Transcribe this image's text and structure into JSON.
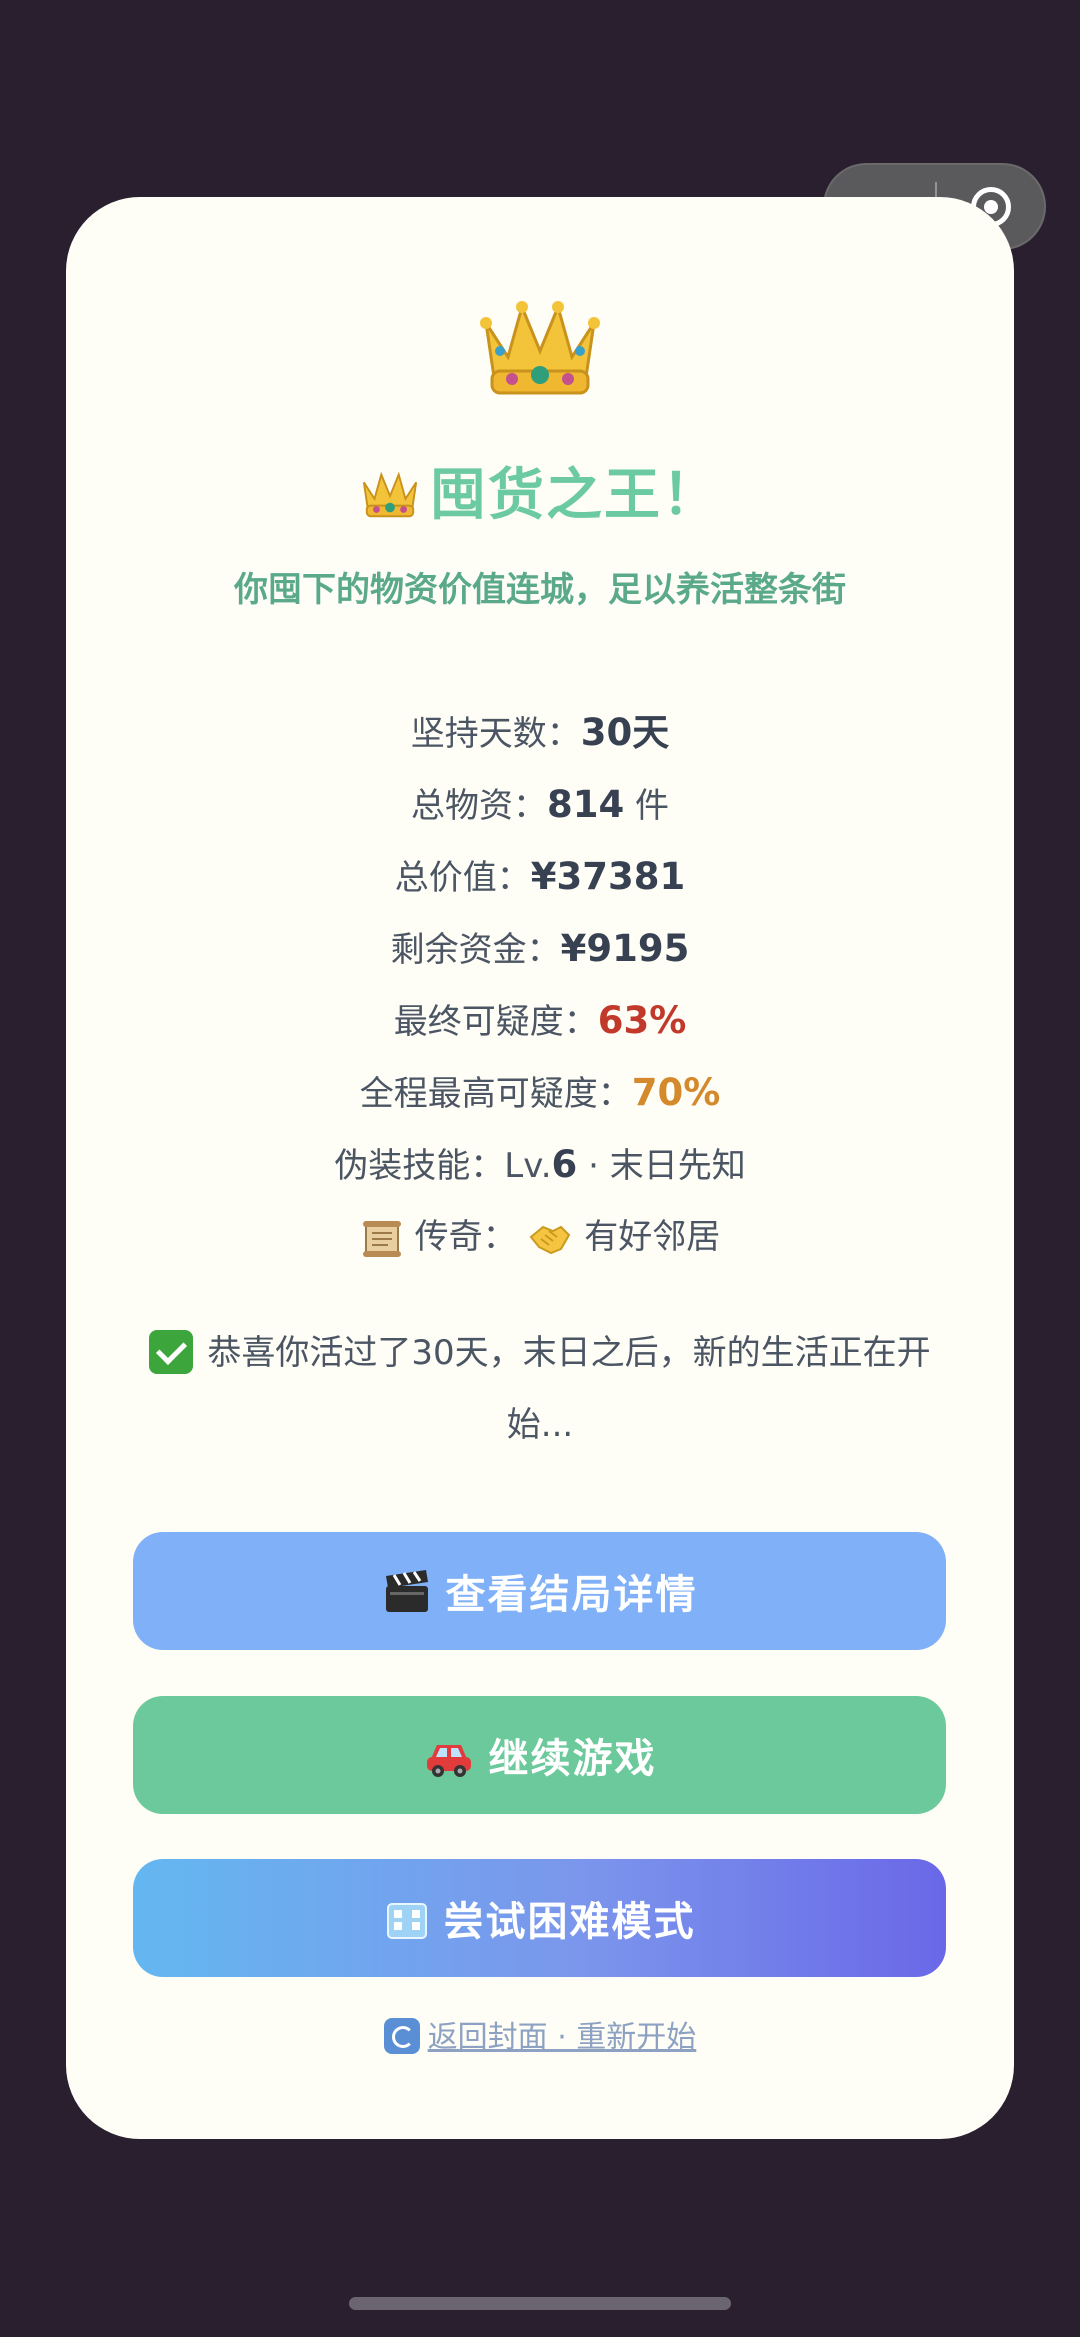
{
  "icons": {
    "crown": "crown-icon",
    "scroll": "scroll-icon",
    "handshake": "handshake-icon",
    "check": "check-mark-icon",
    "clapper": "clapper-board-icon",
    "car": "car-icon",
    "building": "building-icon",
    "refresh": "refresh-icon"
  },
  "title": "囤货之王！",
  "subtitle": "你囤下的物资价值连城，足以养活整条街",
  "stats": {
    "days_label": "坚持天数：",
    "days_value": "30天",
    "items_label": "总物资：",
    "items_value": "814",
    "items_unit": " 件",
    "total_value_label": "总价值：",
    "total_value_value": "¥37381",
    "funds_label": "剩余资金：",
    "funds_value": "¥9195",
    "final_suspicion_label": "最终可疑度：",
    "final_suspicion_value": "63%",
    "max_suspicion_label": "全程最高可疑度：",
    "max_suspicion_value": "70%",
    "skill_label": "伪装技能：",
    "skill_lv_prefix": "Lv.",
    "skill_lv_num": "6",
    "skill_suffix": " · 末日先知",
    "legend_label": "传奇：",
    "legend_value": "有好邻居"
  },
  "congrats": "恭喜你活过了30天，末日之后，新的生活正在开始...",
  "buttons": {
    "details": "查看结局详情",
    "continue": "继续游戏",
    "hard": "尝试困难模式"
  },
  "back_link": "返回封面 · 重新开始",
  "colors": {
    "background": "#2a1f2e",
    "card": "#fefdf6",
    "title": "#6ccaa0",
    "danger": "#c0392b",
    "warning": "#d48a2c",
    "btn_details": "#7fb0f8",
    "btn_continue": "#6bc99b"
  }
}
